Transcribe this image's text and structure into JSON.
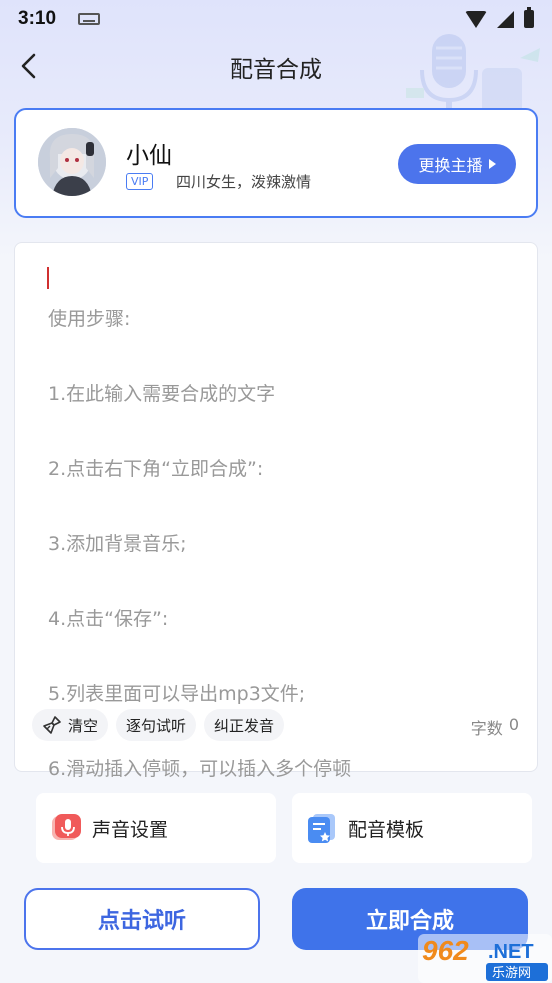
{
  "status_bar": {
    "time": "3:10"
  },
  "nav": {
    "title": "配音合成"
  },
  "anchor": {
    "name": "小仙",
    "vip_label": "VIP",
    "description": "四川女生，泼辣激情",
    "change_button": "更换主播"
  },
  "editor": {
    "placeholder_lines": [
      "使用步骤:",
      "1.在此输入需要合成的文字",
      "2.点击右下角“立即合成”:",
      "3.添加背景音乐;",
      "4.点击“保存”:",
      "5.列表里面可以导出mp3文件;",
      "6.滑动插入停顿，可以插入多个停顿"
    ],
    "tools": {
      "clear": "清空",
      "sentence_preview": "逐句试听",
      "correct_pronunciation": "纠正发音"
    },
    "word_count_label": "字数",
    "word_count_value": "0"
  },
  "features": {
    "voice_settings": "声音设置",
    "dubbing_templates": "配音模板"
  },
  "actions": {
    "preview": "点击试听",
    "synthesize": "立即合成"
  },
  "watermark": {
    "brand": "962",
    "tld": ".NET",
    "site": "乐游网"
  },
  "colors": {
    "accent": "#4c74ec",
    "primary_button": "#3f73ea",
    "feature_red": "#f05a5a",
    "feature_blue": "#4a8cf2"
  }
}
